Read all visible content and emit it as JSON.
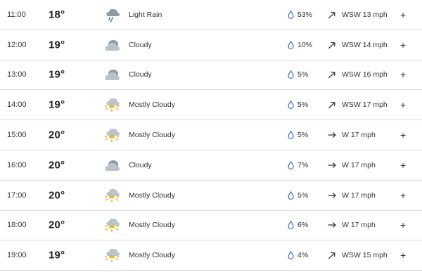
{
  "colors": {
    "cloud": "#b9c3cc",
    "cloud_dark": "#8e9aa6",
    "rain": "#3b79c6",
    "sun": "#f3b21b",
    "drop_stroke": "#3b6fb6",
    "divider": "#dcdcdc"
  },
  "rows": [
    {
      "time": "11:00",
      "temp": "18°",
      "icon": "light-rain-icon",
      "condition": "Light Rain",
      "precip": "53%",
      "wind": "WSW 13 mph",
      "wind_dir": "WSW",
      "expand": "+"
    },
    {
      "time": "12:00",
      "temp": "19°",
      "icon": "cloudy-icon",
      "condition": "Cloudy",
      "precip": "10%",
      "wind": "WSW 14 mph",
      "wind_dir": "WSW",
      "expand": "+"
    },
    {
      "time": "13:00",
      "temp": "19°",
      "icon": "cloudy-icon",
      "condition": "Cloudy",
      "precip": "5%",
      "wind": "WSW 16 mph",
      "wind_dir": "WSW",
      "expand": "+"
    },
    {
      "time": "14:00",
      "temp": "19°",
      "icon": "mostly-cloudy-icon",
      "condition": "Mostly Cloudy",
      "precip": "5%",
      "wind": "WSW 17 mph",
      "wind_dir": "WSW",
      "expand": "+"
    },
    {
      "time": "15:00",
      "temp": "20°",
      "icon": "mostly-cloudy-icon",
      "condition": "Mostly Cloudy",
      "precip": "5%",
      "wind": "W 17 mph",
      "wind_dir": "W",
      "expand": "+"
    },
    {
      "time": "16:00",
      "temp": "20°",
      "icon": "cloudy-icon",
      "condition": "Cloudy",
      "precip": "7%",
      "wind": "W 17 mph",
      "wind_dir": "W",
      "expand": "+"
    },
    {
      "time": "17:00",
      "temp": "20°",
      "icon": "mostly-cloudy-icon",
      "condition": "Mostly Cloudy",
      "precip": "5%",
      "wind": "W 17 mph",
      "wind_dir": "W",
      "expand": "+"
    },
    {
      "time": "18:00",
      "temp": "20°",
      "icon": "mostly-cloudy-icon",
      "condition": "Mostly Cloudy",
      "precip": "6%",
      "wind": "W 17 mph",
      "wind_dir": "W",
      "expand": "+"
    },
    {
      "time": "19:00",
      "temp": "19°",
      "icon": "mostly-cloudy-icon",
      "condition": "Mostly Cloudy",
      "precip": "4%",
      "wind": "WSW 15 mph",
      "wind_dir": "WSW",
      "expand": "+"
    }
  ]
}
